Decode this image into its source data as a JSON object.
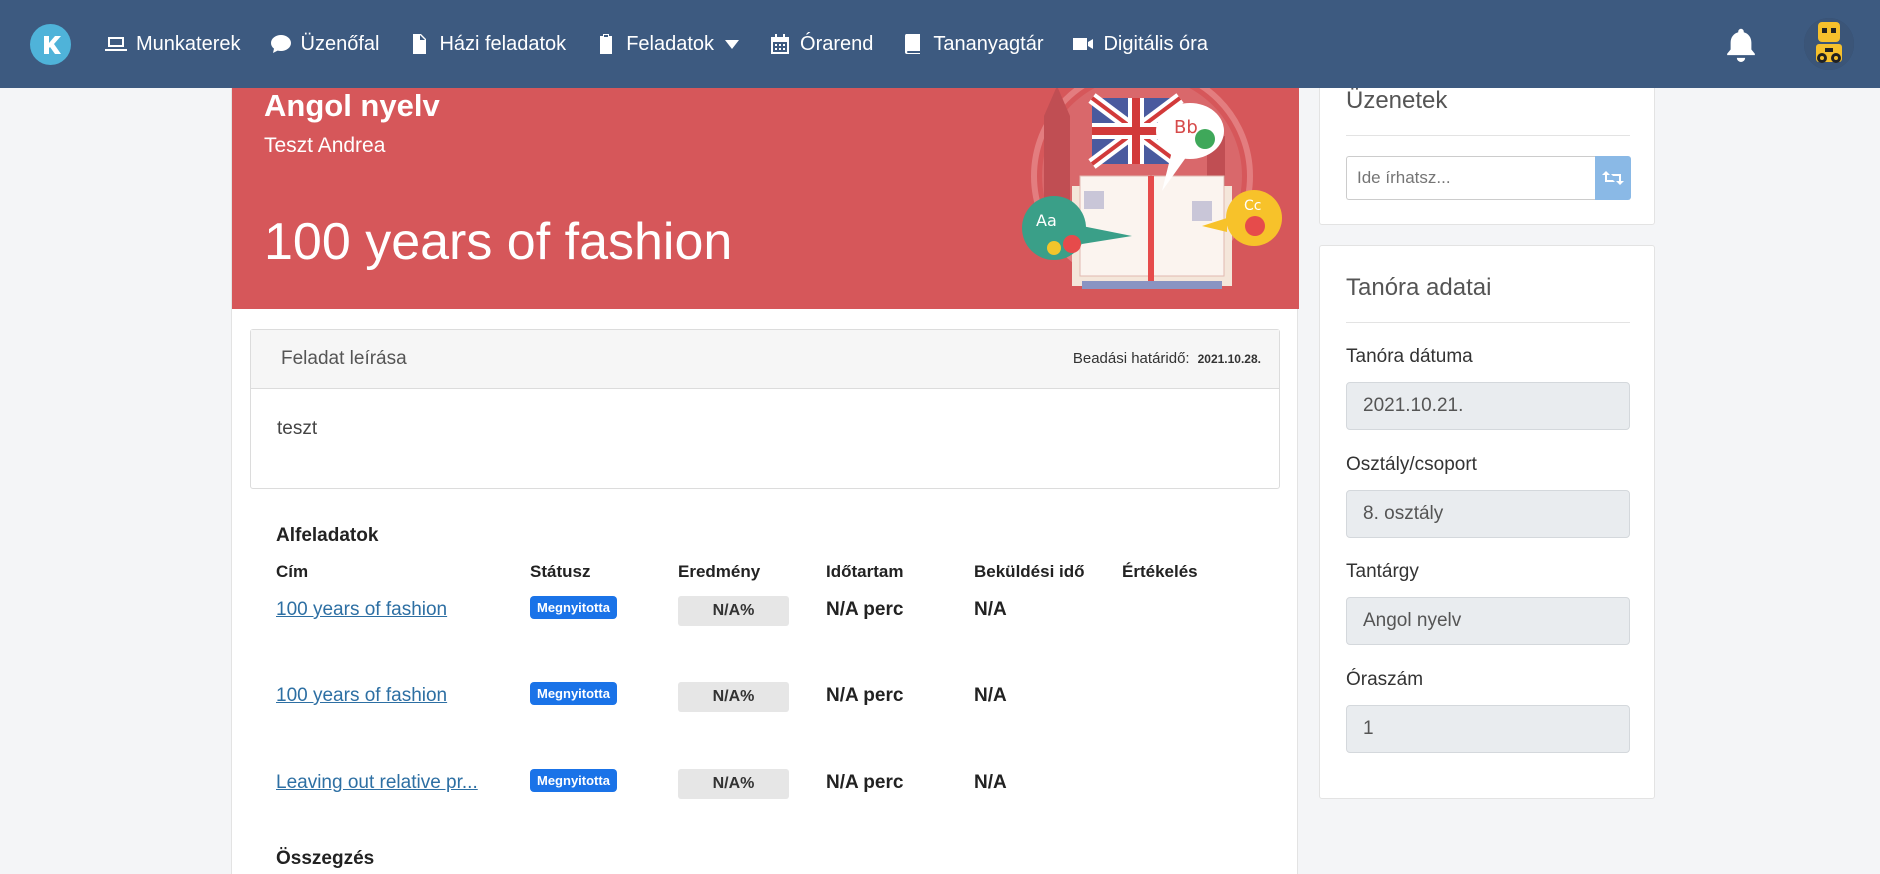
{
  "nav": {
    "items": [
      {
        "label": "Munkaterek",
        "icon": "laptop-icon"
      },
      {
        "label": "Üzenőfal",
        "icon": "chat-icon"
      },
      {
        "label": "Házi feladatok",
        "icon": "document-icon"
      },
      {
        "label": "Feladatok",
        "icon": "clipboard-icon"
      },
      {
        "label": "Órarend",
        "icon": "calendar-icon"
      },
      {
        "label": "Tananyagtár",
        "icon": "book-icon"
      },
      {
        "label": "Digitális óra",
        "icon": "video-camera-icon"
      }
    ]
  },
  "banner": {
    "subject": "Angol nyelv",
    "teacher": "Teszt Andrea",
    "title": "100 years of fashion"
  },
  "task": {
    "header": "Feladat leírása",
    "deadline_label": "Beadási határidő:",
    "deadline_value": "2021.10.28.",
    "description": "teszt"
  },
  "subtasks": {
    "title": "Alfeladatok",
    "columns": [
      "Cím",
      "Státusz",
      "Eredmény",
      "Időtartam",
      "Beküldési idő",
      "Értékelés"
    ],
    "rows": [
      {
        "title": "100 years of fashion",
        "status": "Megnyitotta",
        "result": "N/A%",
        "duration": "N/A perc",
        "sent": "N/A"
      },
      {
        "title": "100 years of fashion",
        "status": "Megnyitotta",
        "result": "N/A%",
        "duration": "N/A perc",
        "sent": "N/A"
      },
      {
        "title": "Leaving out relative pr...",
        "status": "Megnyitotta",
        "result": "N/A%",
        "duration": "N/A perc",
        "sent": "N/A"
      }
    ],
    "summary_title": "Összegzés"
  },
  "messages": {
    "title": "Üzenetek",
    "placeholder": "Ide írhatsz..."
  },
  "lesson": {
    "title": "Tanóra adatai",
    "fields": [
      {
        "label": "Tanóra dátuma",
        "value": "2021.10.21."
      },
      {
        "label": "Osztály/csoport",
        "value": "8. osztály"
      },
      {
        "label": "Tantárgy",
        "value": "Angol nyelv"
      },
      {
        "label": "Óraszám",
        "value": "1"
      }
    ]
  },
  "colors": {
    "navbar": "#3d5a80",
    "banner": "#d6575a",
    "badge": "#1a73e8",
    "link": "#2d6fa3"
  }
}
